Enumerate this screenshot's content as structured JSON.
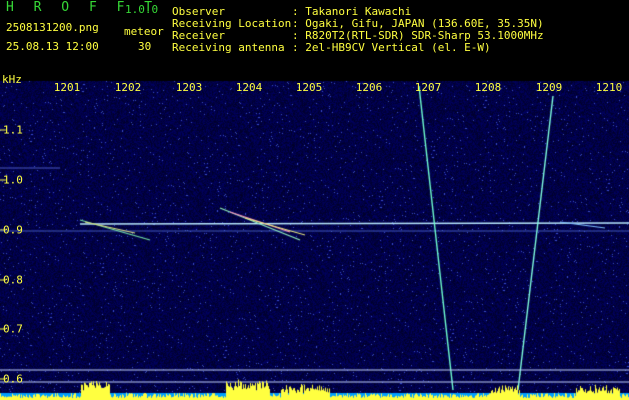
{
  "app": {
    "title": "H R O F F T",
    "version": "1.0.0"
  },
  "file": {
    "name": "2508131200.png",
    "timestamp": "25.08.13 12:00"
  },
  "meteor": {
    "label": "meteor",
    "count": "30"
  },
  "info": [
    {
      "label": "Observer",
      "value": ": Takanori Kawachi"
    },
    {
      "label": "Receiving Location",
      "value": ": Ogaki, Gifu, JAPAN (136.60E, 35.35N)"
    },
    {
      "label": "Receiver",
      "value": ": R820T2(RTL-SDR) SDR-Sharp 53.1000MHz"
    },
    {
      "label": "Receiving antenna",
      "value": ": 2el-HB9CV Vertical (el. E-W)"
    }
  ],
  "axis": {
    "y_unit": "kHz",
    "x_ticks": [
      "1201",
      "1202",
      "1203",
      "1204",
      "1205",
      "1206",
      "1207",
      "1208",
      "1209",
      "1210"
    ],
    "y_ticks": [
      "1.1",
      "1.0",
      "0.9",
      "0.8",
      "0.7",
      "0.6"
    ]
  },
  "colors": {
    "label": "#ffff40",
    "title": "#36d836",
    "background_noise": "#0a0a4a",
    "signal": "#c0f0ff",
    "histogram": "#ffff40"
  }
}
